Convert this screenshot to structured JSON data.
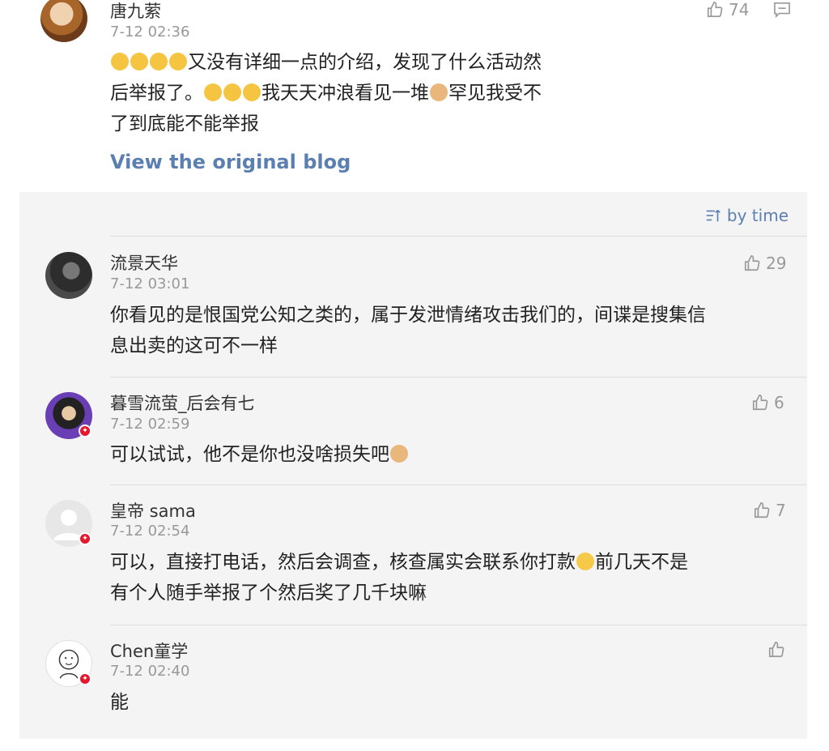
{
  "main_post": {
    "author": "唐九萦",
    "time": "7-12 02:36",
    "likes": "74",
    "text_lines": [
      "又没有详细一点的介绍，发现了什么活动然",
      "后举报了。",
      "我天天冲浪看见一堆",
      "罕见我受不",
      "了到底能不能举报"
    ],
    "view_original": "View the original blog"
  },
  "sort_label": "by time",
  "comments": [
    {
      "author": "流景天华",
      "time": "7-12 03:01",
      "likes": "29",
      "text_line1": "你看见的是恨国党公知之类的，属于发泄情绪攻击我们的，间谍是搜集信",
      "text_line2": "息出卖的这可不一样"
    },
    {
      "author": "暮雪流萤_后会有七",
      "time": "7-12 02:59",
      "likes": "6",
      "text_line1": "可以试试，他不是你也没啥损失吧"
    },
    {
      "author": "皇帝 sama",
      "time": "7-12 02:54",
      "likes": "7",
      "text_line1": "可以，直接打电话，然后会调查，核查属实会联系你打款",
      "text_line1b": "前几天不是",
      "text_line2": "有个人随手举报了个然后奖了几千块嘛"
    },
    {
      "author": "Chen童学",
      "time": "7-12 02:40",
      "likes": "",
      "text_line1": "能"
    }
  ],
  "colors": {
    "link": "#5b7fb0",
    "panel_bg": "#f4f4f4",
    "badge": "#e6162d"
  }
}
